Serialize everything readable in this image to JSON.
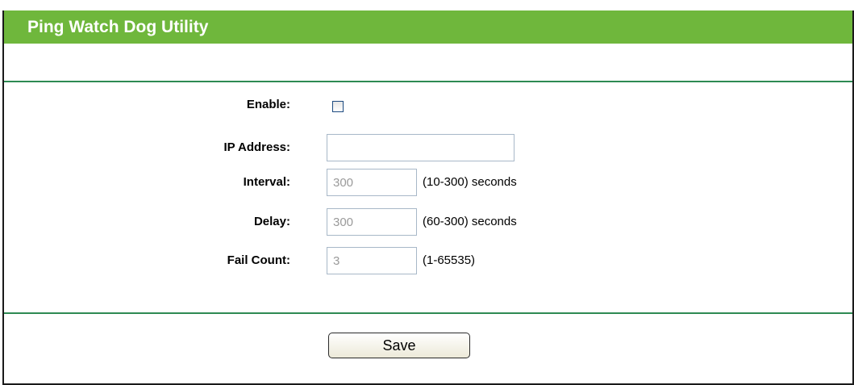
{
  "page": {
    "title": "Ping Watch Dog Utility"
  },
  "form": {
    "enable": {
      "label": "Enable:",
      "checked": false
    },
    "ip_address": {
      "label": "IP Address:",
      "value": ""
    },
    "interval": {
      "label": "Interval:",
      "value": "300",
      "hint": "(10-300) seconds"
    },
    "delay": {
      "label": "Delay:",
      "value": "300",
      "hint": "(60-300) seconds"
    },
    "fail_count": {
      "label": "Fail Count:",
      "value": "3",
      "hint": "(1-65535)"
    }
  },
  "actions": {
    "save_label": "Save"
  },
  "colors": {
    "title_bar": "#6fb73c",
    "divider": "#2e8a53",
    "frame_border": "#1a1a1a"
  }
}
